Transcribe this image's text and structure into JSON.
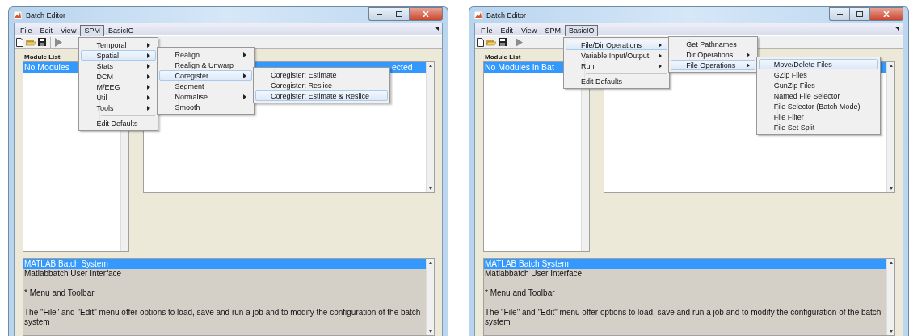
{
  "windows": [
    {
      "title": "Batch Editor",
      "menu_bar": [
        {
          "label": "File",
          "selected": false
        },
        {
          "label": "Edit",
          "selected": false
        },
        {
          "label": "View",
          "selected": false
        },
        {
          "label": "SPM",
          "selected": true,
          "menu": [
            {
              "kind": "item",
              "label": "Temporal",
              "submenu": true,
              "selected": false
            },
            {
              "kind": "item",
              "label": "Spatial",
              "submenu": true,
              "selected": true,
              "children": [
                {
                  "kind": "item",
                  "label": "Realign",
                  "submenu": true,
                  "selected": false
                },
                {
                  "kind": "item",
                  "label": "Realign & Unwarp",
                  "submenu": false,
                  "selected": false
                },
                {
                  "kind": "item",
                  "label": "Coregister",
                  "submenu": true,
                  "selected": true,
                  "children": [
                    {
                      "kind": "item",
                      "label": "Coregister: Estimate",
                      "submenu": false,
                      "selected": false
                    },
                    {
                      "kind": "item",
                      "label": "Coregister: Reslice",
                      "submenu": false,
                      "selected": false
                    },
                    {
                      "kind": "item",
                      "label": "Coregister: Estimate & Reslice",
                      "submenu": false,
                      "selected": true
                    }
                  ]
                },
                {
                  "kind": "item",
                  "label": "Segment",
                  "submenu": false,
                  "selected": false
                },
                {
                  "kind": "item",
                  "label": "Normalise",
                  "submenu": true,
                  "selected": false
                },
                {
                  "kind": "item",
                  "label": "Smooth",
                  "submenu": false,
                  "selected": false
                }
              ]
            },
            {
              "kind": "item",
              "label": "Stats",
              "submenu": true,
              "selected": false
            },
            {
              "kind": "item",
              "label": "DCM",
              "submenu": true,
              "selected": false
            },
            {
              "kind": "item",
              "label": "M/EEG",
              "submenu": true,
              "selected": false
            },
            {
              "kind": "item",
              "label": "Util",
              "submenu": true,
              "selected": false
            },
            {
              "kind": "item",
              "label": "Tools",
              "submenu": true,
              "selected": false
            },
            {
              "kind": "separator"
            },
            {
              "kind": "item",
              "label": "Edit Defaults",
              "submenu": false,
              "selected": false
            }
          ]
        },
        {
          "label": "BasicIO",
          "selected": false
        }
      ],
      "module_list_label": "Module List",
      "module_list": [
        {
          "label": "No Modules",
          "selected": true
        }
      ],
      "detail_list": [
        {
          "label": "ected",
          "selected": true
        }
      ],
      "help_lines": [
        {
          "text": "MATLAB Batch System",
          "selected": true,
          "space_before": false
        },
        {
          "text": "Matlabbatch User Interface",
          "selected": false,
          "space_before": false
        },
        {
          "text": "* Menu and Toolbar",
          "selected": false,
          "space_before": true
        },
        {
          "text": "The  \"File\" and \"Edit\" menu offer options to load, save and run a job and to modify the configuration of the batch system",
          "selected": false,
          "space_before": true
        }
      ]
    },
    {
      "title": "Batch Editor",
      "menu_bar": [
        {
          "label": "File",
          "selected": false
        },
        {
          "label": "Edit",
          "selected": false
        },
        {
          "label": "View",
          "selected": false
        },
        {
          "label": "SPM",
          "selected": false
        },
        {
          "label": "BasicIO",
          "selected": true,
          "menu": [
            {
              "kind": "item",
              "label": "File/Dir Operations",
              "submenu": true,
              "selected": true,
              "children": [
                {
                  "kind": "item",
                  "label": "Get Pathnames",
                  "submenu": false,
                  "selected": false
                },
                {
                  "kind": "item",
                  "label": "Dir Operations",
                  "submenu": true,
                  "selected": false
                },
                {
                  "kind": "item",
                  "label": "File Operations",
                  "submenu": true,
                  "selected": true,
                  "children": [
                    {
                      "kind": "item",
                      "label": "Move/Delete Files",
                      "submenu": false,
                      "selected": true
                    },
                    {
                      "kind": "item",
                      "label": "GZip Files",
                      "submenu": false,
                      "selected": false
                    },
                    {
                      "kind": "item",
                      "label": "GunZip Files",
                      "submenu": false,
                      "selected": false
                    },
                    {
                      "kind": "item",
                      "label": "Named File Selector",
                      "submenu": false,
                      "selected": false
                    },
                    {
                      "kind": "item",
                      "label": "File Selector (Batch Mode)",
                      "submenu": false,
                      "selected": false
                    },
                    {
                      "kind": "item",
                      "label": "File Filter",
                      "submenu": false,
                      "selected": false
                    },
                    {
                      "kind": "item",
                      "label": "File Set Split",
                      "submenu": false,
                      "selected": false
                    }
                  ]
                }
              ]
            },
            {
              "kind": "item",
              "label": "Variable Input/Output",
              "submenu": true,
              "selected": false
            },
            {
              "kind": "item",
              "label": "Run",
              "submenu": true,
              "selected": false
            },
            {
              "kind": "separator"
            },
            {
              "kind": "item",
              "label": "Edit Defaults",
              "submenu": false,
              "selected": false
            }
          ]
        }
      ],
      "module_list_label": "Module List",
      "module_list": [
        {
          "label": "No Modules in Bat",
          "selected": true
        }
      ],
      "detail_list": [
        {
          "selected": true
        }
      ],
      "help_lines": [
        {
          "text": "MATLAB Batch System",
          "selected": true,
          "space_before": false
        },
        {
          "text": "Matlabbatch User Interface",
          "selected": false,
          "space_before": false
        },
        {
          "text": "* Menu and Toolbar",
          "selected": false,
          "space_before": true
        },
        {
          "text": "The  \"File\" and \"Edit\" menu offer options to load, save and run a job and to modify the configuration of the batch system",
          "selected": false,
          "space_before": true
        }
      ]
    }
  ]
}
